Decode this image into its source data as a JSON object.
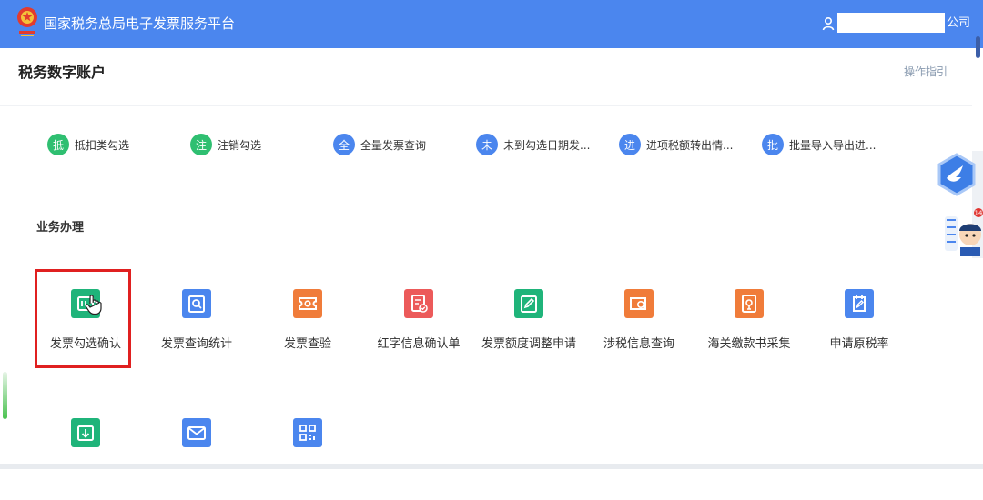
{
  "header": {
    "title": "国家税务总局电子发票服务平台",
    "user_name": "",
    "user_suffix": "公司",
    "logo_icon": "tax-emblem-icon",
    "user_icon": "user-icon"
  },
  "page": {
    "title": "税务数字账户",
    "guide_link": "操作指引"
  },
  "quick_actions": [
    {
      "badge": "抵",
      "label": "抵扣类勾选",
      "color": "#2fbf71"
    },
    {
      "badge": "注",
      "label": "注销勾选",
      "color": "#2fbf71"
    },
    {
      "badge": "全",
      "label": "全量发票查询",
      "color": "#4b86ee"
    },
    {
      "badge": "未",
      "label": "未到勾选日期发...",
      "color": "#4b86ee"
    },
    {
      "badge": "进",
      "label": "进项税额转出情...",
      "color": "#4b86ee"
    },
    {
      "badge": "批",
      "label": "批量导入导出进...",
      "color": "#4b86ee"
    }
  ],
  "business": {
    "section_title": "业务办理",
    "tiles": [
      {
        "label": "发票勾选确认",
        "icon": "invoice-check-icon",
        "color": "#1fb47a"
      },
      {
        "label": "发票查询统计",
        "icon": "invoice-search-icon",
        "color": "#4b86ee"
      },
      {
        "label": "发票查验",
        "icon": "ticket-verify-icon",
        "color": "#f07c3a"
      },
      {
        "label": "红字信息确认单",
        "icon": "red-letter-doc-icon",
        "color": "#ec5a5a"
      },
      {
        "label": "发票额度调整申请",
        "icon": "quota-edit-icon",
        "color": "#1fb47a"
      },
      {
        "label": "涉税信息查询",
        "icon": "tax-info-search-icon",
        "color": "#f07c3a"
      },
      {
        "label": "海关缴款书采集",
        "icon": "customs-doc-icon",
        "color": "#f07c3a"
      },
      {
        "label": "申请原税率",
        "icon": "apply-rate-icon",
        "color": "#4b86ee"
      },
      {
        "label": "",
        "icon": "download-box-icon",
        "color": "#1fb47a"
      },
      {
        "label": "",
        "icon": "mail-icon",
        "color": "#4b86ee"
      },
      {
        "label": "",
        "icon": "qr-code-icon",
        "color": "#4b86ee"
      }
    ]
  },
  "floating": {
    "bird_icon": "bird-badge-icon",
    "assistant_icon": "tax-assistant-icon",
    "assistant_badge": "14"
  }
}
